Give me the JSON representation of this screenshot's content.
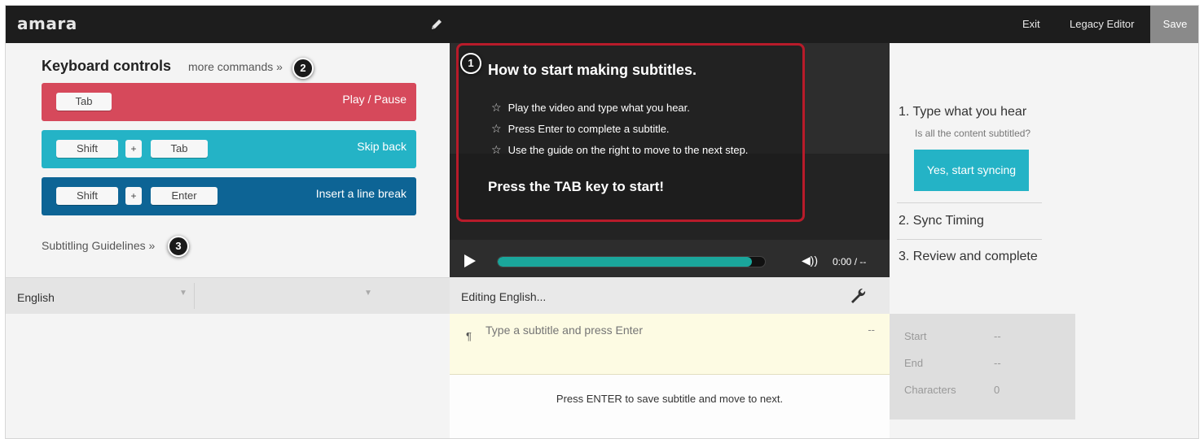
{
  "topbar": {
    "logo": "amara",
    "exit_label": "Exit",
    "legacy_label": "Legacy Editor",
    "save_label": "Save"
  },
  "keyboard": {
    "title": "Keyboard controls",
    "more_commands": "more commands »",
    "rows": [
      {
        "keys": [
          "Tab"
        ],
        "action": "Play / Pause",
        "color": "#d6495b"
      },
      {
        "keys": [
          "Shift",
          "+",
          "Tab"
        ],
        "action": "Skip back",
        "color": "#24b3c6"
      },
      {
        "keys": [
          "Shift",
          "+",
          "Enter"
        ],
        "action": "Insert a line break",
        "color": "#0d6495"
      }
    ],
    "guidelines": "Subtitling Guidelines »"
  },
  "badges": {
    "one": "1",
    "two": "2",
    "three": "3"
  },
  "language": {
    "selected": "English",
    "second": ""
  },
  "overlay": {
    "title": "How to start making subtitles.",
    "items": [
      "Play the video and type what you hear.",
      "Press Enter to complete a subtitle.",
      "Use the guide on the right to move to the next step."
    ],
    "tab_hint": "Press the TAB key to start!"
  },
  "player": {
    "time": "0:00 / --",
    "progress": 0.95
  },
  "editor": {
    "label": "Editing English...",
    "placeholder": "Type a subtitle and press Enter",
    "dash": "--",
    "hint": "Press ENTER to save subtitle and move to next."
  },
  "steps": {
    "step1": "1. Type what you hear",
    "step1_sub": "Is all the content subtitled?",
    "sync_button": "Yes, start syncing",
    "step2": "2. Sync Timing",
    "step3": "3. Review and complete"
  },
  "info": {
    "start_label": "Start",
    "start_value": "--",
    "end_label": "End",
    "end_value": "--",
    "chars_label": "Characters",
    "chars_value": "0"
  },
  "colors": {
    "accent": "#24b3c6",
    "overlay_border": "#b81b2a",
    "progress": "#1aa69b"
  }
}
